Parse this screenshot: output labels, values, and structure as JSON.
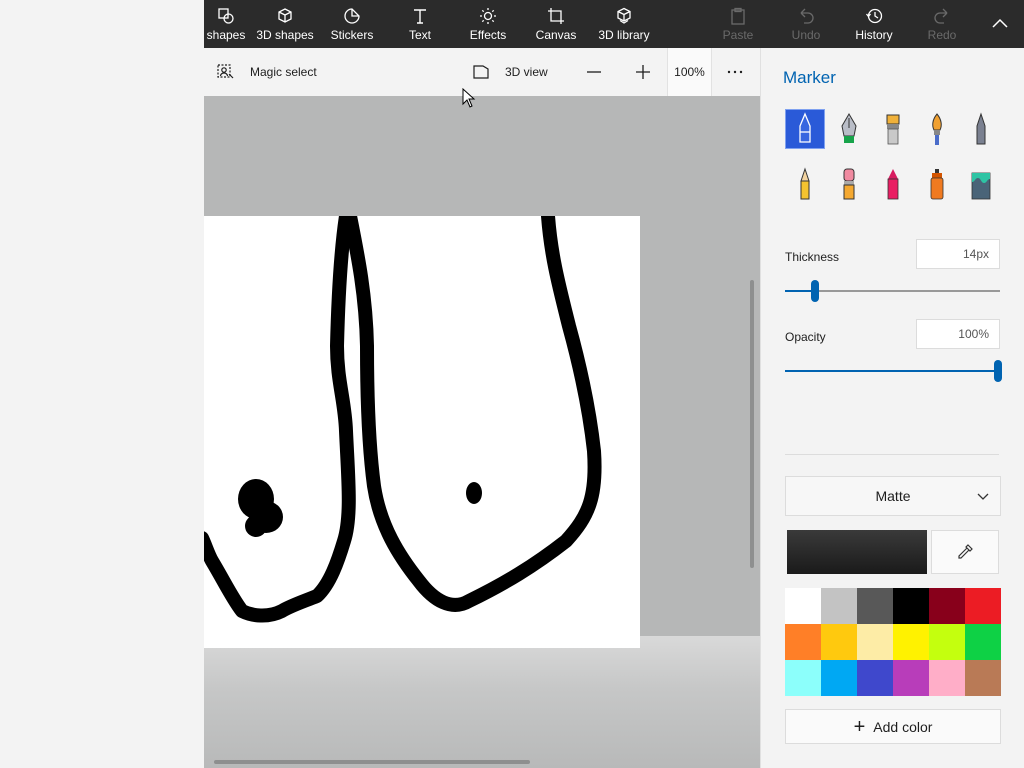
{
  "toolbar": {
    "items": [
      {
        "label": "shapes",
        "icon": "2d-shapes-icon"
      },
      {
        "label": "3D shapes",
        "icon": "cube-icon"
      },
      {
        "label": "Stickers",
        "icon": "sticker-icon"
      },
      {
        "label": "Text",
        "icon": "text-icon"
      },
      {
        "label": "Effects",
        "icon": "sun-effects-icon"
      },
      {
        "label": "Canvas",
        "icon": "canvas-crop-icon"
      },
      {
        "label": "3D library",
        "icon": "3d-library-icon"
      }
    ],
    "paste_label": "Paste",
    "undo_label": "Undo",
    "history_label": "History",
    "redo_label": "Redo"
  },
  "subtoolbar": {
    "magic_select_label": "Magic select",
    "view3d_label": "3D view",
    "zoom": "100%"
  },
  "panel": {
    "title": "Marker",
    "brushes": [
      "marker-brush",
      "calligraphy-pen-brush",
      "oil-brush",
      "watercolor-brush",
      "pixel-pen-brush",
      "pencil-brush",
      "eraser-brush",
      "crayon-brush",
      "spray-can-brush",
      "fill-bucket-brush"
    ],
    "thickness_label": "Thickness",
    "thickness_value": "14px",
    "thickness_level": 0.14,
    "opacity_label": "Opacity",
    "opacity_value": "100%",
    "opacity_level": 1.0,
    "finish": "Matte",
    "current_color": "#1a1a1a",
    "palette": [
      "#ffffff",
      "#c3c3c3",
      "#585858",
      "#000000",
      "#88001b",
      "#ec1c24",
      "#ff7f27",
      "#ffc90e",
      "#fdeca6",
      "#fff200",
      "#c4ff0e",
      "#0ed145",
      "#8cfffb",
      "#00a8f3",
      "#3f48cc",
      "#b83dba",
      "#ffaec8",
      "#b97a56"
    ],
    "add_color_label": "Add color"
  },
  "accent": "#0063b1"
}
